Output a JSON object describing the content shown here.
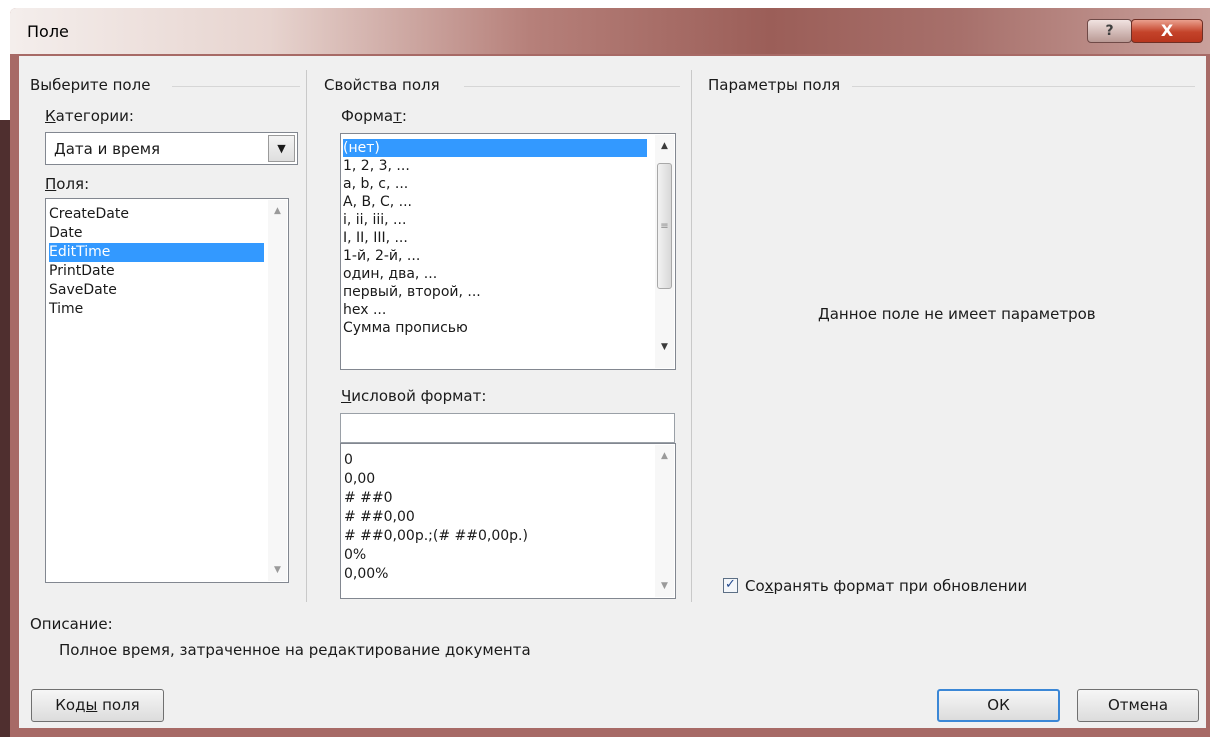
{
  "window": {
    "title": "Поле",
    "help_label": "?",
    "close_label": "X"
  },
  "select_field": {
    "group_title": "Выберите поле",
    "categories_label_u": "К",
    "categories_label_rest": "атегории:",
    "category_value": "Дата и время",
    "fields_label_u": "П",
    "fields_label_rest": "оля:",
    "fields": [
      "CreateDate",
      "Date",
      "EditTime",
      "PrintDate",
      "SaveDate",
      "Time"
    ],
    "selected_field": "EditTime"
  },
  "field_properties": {
    "group_title": "Свойства поля",
    "format_label_pre": "Форма",
    "format_label_u": "т",
    "format_label_post": ":",
    "formats": [
      "(нет)",
      "1, 2, 3, ...",
      "a, b, c, ...",
      "A, B, C, ...",
      "i, ii, iii, ...",
      "I, II, III, ...",
      "1-й, 2-й, ...",
      "один, два, ...",
      "первый, второй, ...",
      "hex ...",
      "Сумма прописью"
    ],
    "selected_format": "(нет)",
    "numeric_label_u": "Ч",
    "numeric_label_rest": "исловой формат:",
    "numeric_value": "",
    "numeric_formats": [
      "0",
      "0,00",
      "# ##0",
      "# ##0,00",
      "# ##0,00р.;(# ##0,00р.)",
      "0%",
      "0,00%"
    ]
  },
  "field_options": {
    "group_title": "Параметры поля",
    "no_options_text": "Данное поле не имеет параметров",
    "preserve_label_pre": "Со",
    "preserve_label_u": "х",
    "preserve_label_post": "ранять формат при обновлении",
    "preserve_checked": true
  },
  "description": {
    "label": "Описание:",
    "text": "Полное время, затраченное на редактирование документа"
  },
  "buttons": {
    "field_codes_pre": "Ко",
    "field_codes_u": "ды",
    "field_codes_post": " поля",
    "ok": "ОК",
    "cancel": "Отмена"
  },
  "colors": {
    "selection": "#3399ff",
    "dialog_bg": "#f0f0f0",
    "default_button_border": "#3b87d6"
  }
}
